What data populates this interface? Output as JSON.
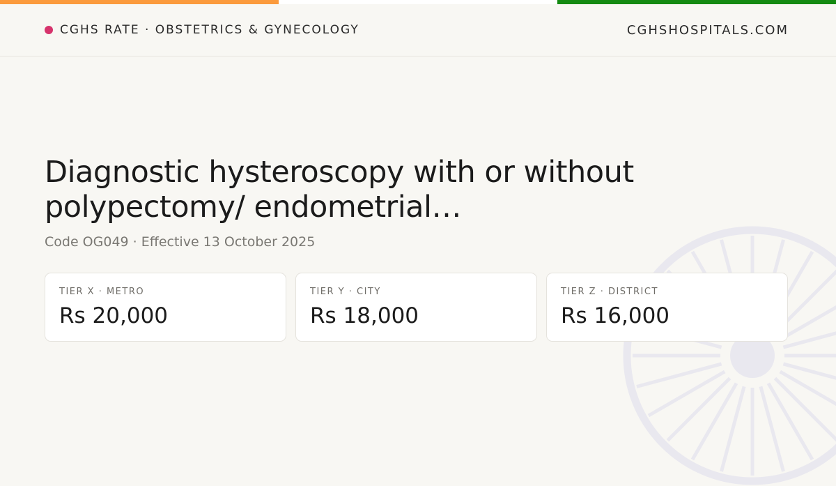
{
  "colors": {
    "stripe_saffron": "#fb9a3c",
    "stripe_white": "#ffffff",
    "stripe_green": "#148a12",
    "dot_accent": "#d6336c",
    "wheel": "#e9e8ef"
  },
  "header": {
    "brand_label": "CGHS RATE · OBSTETRICS & GYNECOLOGY",
    "site_label": "CGHSHOSPITALS.COM"
  },
  "procedure": {
    "title": "Diagnostic hysteroscopy with or without polypectomy/ endometrial…",
    "meta": "Code OG049 · Effective 13 October 2025"
  },
  "tiers": [
    {
      "label": "TIER X · METRO",
      "price": "Rs 20,000"
    },
    {
      "label": "TIER Y · CITY",
      "price": "Rs 18,000"
    },
    {
      "label": "TIER Z · DISTRICT",
      "price": "Rs 16,000"
    }
  ],
  "decoration": {
    "wheel_icon": "ashoka-chakra-icon"
  }
}
